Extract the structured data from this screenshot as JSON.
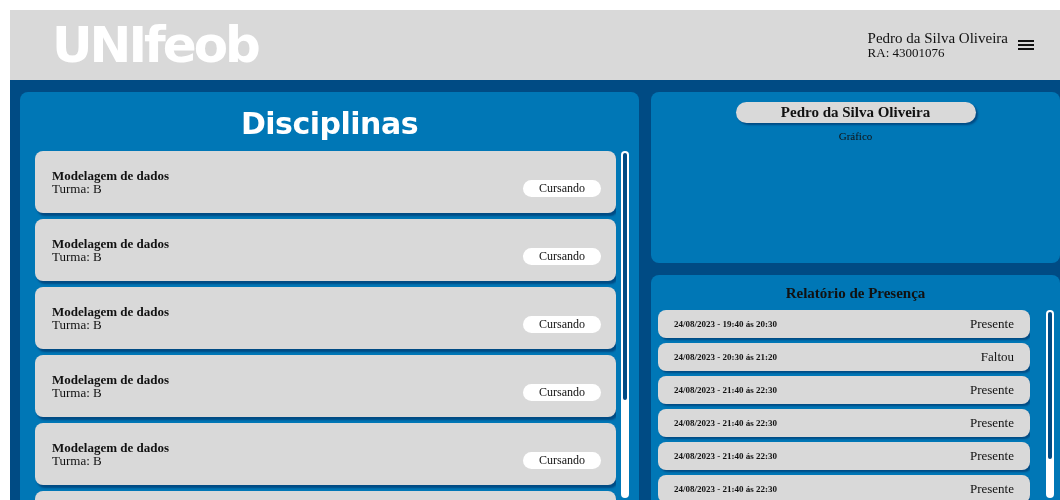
{
  "header": {
    "logo": "UNIfeob",
    "user_name": "Pedro da Silva Oliveira",
    "user_ra": "RA: 43001076"
  },
  "disciplinas": {
    "title": "Disciplinas",
    "items": [
      {
        "name": "Modelagem de dados",
        "turma": "Turma: B",
        "status": "Cursando"
      },
      {
        "name": "Modelagem de dados",
        "turma": "Turma: B",
        "status": "Cursando"
      },
      {
        "name": "Modelagem de dados",
        "turma": "Turma: B",
        "status": "Cursando"
      },
      {
        "name": "Modelagem de dados",
        "turma": "Turma: B",
        "status": "Cursando"
      },
      {
        "name": "Modelagem de dados",
        "turma": "Turma: B",
        "status": "Cursando"
      }
    ]
  },
  "grafico": {
    "student": "Pedro da Silva Oliveira",
    "label": "Gráfico"
  },
  "presenca": {
    "title": "Relatório de Presença",
    "rows": [
      {
        "date": "24/08/2023 - 19:40 ás 20:30",
        "status": "Presente"
      },
      {
        "date": "24/08/2023 - 20:30 ás 21:20",
        "status": "Faltou"
      },
      {
        "date": "24/08/2023 - 21:40 ás 22:30",
        "status": "Presente"
      },
      {
        "date": "24/08/2023 - 21:40 ás 22:30",
        "status": "Presente"
      },
      {
        "date": "24/08/2023 - 21:40 ás 22:30",
        "status": "Presente"
      },
      {
        "date": "24/08/2023 - 21:40 ás 22:30",
        "status": "Presente"
      }
    ]
  }
}
